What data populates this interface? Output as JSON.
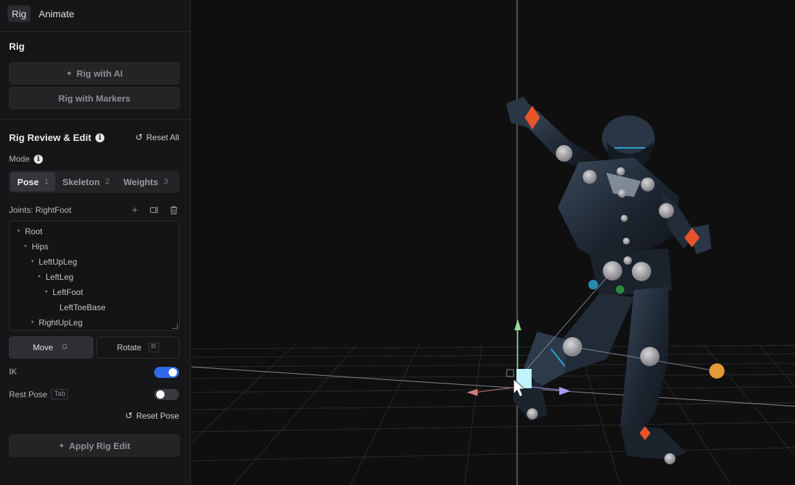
{
  "tabs": [
    {
      "label": "Rig",
      "active": true
    },
    {
      "label": "Animate",
      "active": false
    }
  ],
  "rig_section": {
    "title": "Rig",
    "rig_ai_label": "Rig with AI",
    "rig_markers_label": "Rig with Markers"
  },
  "review": {
    "title": "Rig Review & Edit",
    "reset_all_label": "Reset All",
    "mode_label": "Mode",
    "modes": [
      {
        "label": "Pose",
        "key": "1",
        "active": true
      },
      {
        "label": "Skeleton",
        "key": "2",
        "active": false
      },
      {
        "label": "Weights",
        "key": "3",
        "active": false
      }
    ],
    "joints_label": "Joints: RightFoot",
    "tree": [
      {
        "label": "Root",
        "depth": 0,
        "expanded": true
      },
      {
        "label": "Hips",
        "depth": 1,
        "expanded": true
      },
      {
        "label": "LeftUpLeg",
        "depth": 2,
        "expanded": true
      },
      {
        "label": "LeftLeg",
        "depth": 3,
        "expanded": true
      },
      {
        "label": "LeftFoot",
        "depth": 4,
        "expanded": true
      },
      {
        "label": "LeftToeBase",
        "depth": 5,
        "expanded": false
      },
      {
        "label": "RightUpLeg",
        "depth": 2,
        "expanded": true
      }
    ],
    "tools": {
      "move_label": "Move",
      "move_key": "G",
      "rotate_label": "Rotate",
      "rotate_key": "R"
    },
    "ik_label": "IK",
    "ik_on": true,
    "rest_pose_label": "Rest Pose",
    "rest_pose_key": "Tab",
    "rest_pose_on": false,
    "reset_pose_label": "Reset Pose",
    "apply_label": "Apply Rig Edit"
  },
  "colors": {
    "accent": "#2f6be8",
    "ik_handle": "#e8542a",
    "joint": "#b5b5b8",
    "pole_target": "#e39a3a",
    "gizmo_y": "#8fe09a",
    "gizmo_x": "#d07a7a",
    "gizmo_z": "#a99af0"
  }
}
